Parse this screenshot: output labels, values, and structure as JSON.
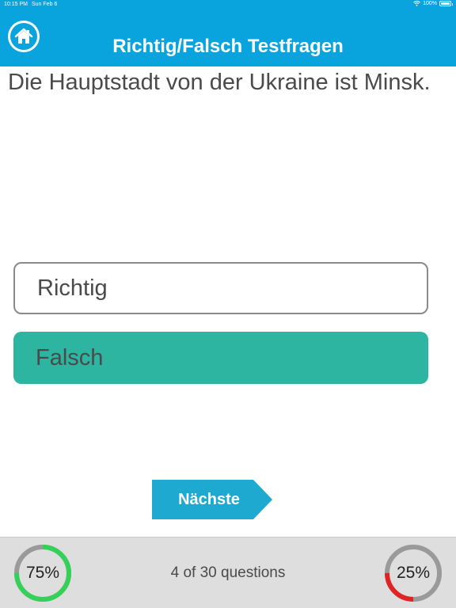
{
  "status_bar": {
    "time": "10:15 PM",
    "date": "Sun Feb 6",
    "battery": "100%",
    "wifi_icon": "wifi-icon",
    "battery_icon": "battery-icon"
  },
  "nav": {
    "title": "Richtig/Falsch Testfragen",
    "home_icon": "home-icon"
  },
  "question": {
    "text": "Die Hauptstadt von der Ukraine ist Minsk."
  },
  "answers": [
    {
      "label": "Richtig",
      "selected": false
    },
    {
      "label": "Falsch",
      "selected": true
    }
  ],
  "next_button": {
    "label": "Nächste"
  },
  "footer": {
    "progress_text": "4 of 30 questions",
    "correct": {
      "label": "75%",
      "fraction": 0.75,
      "color": "#34d058",
      "track": "#9a9a9a"
    },
    "wrong": {
      "label": "25%",
      "fraction": 0.25,
      "color": "#e02424",
      "track": "#9a9a9a"
    }
  },
  "colors": {
    "accent": "#09a3de",
    "selected_answer": "#2db5a2",
    "next_button": "#1eaad0"
  }
}
